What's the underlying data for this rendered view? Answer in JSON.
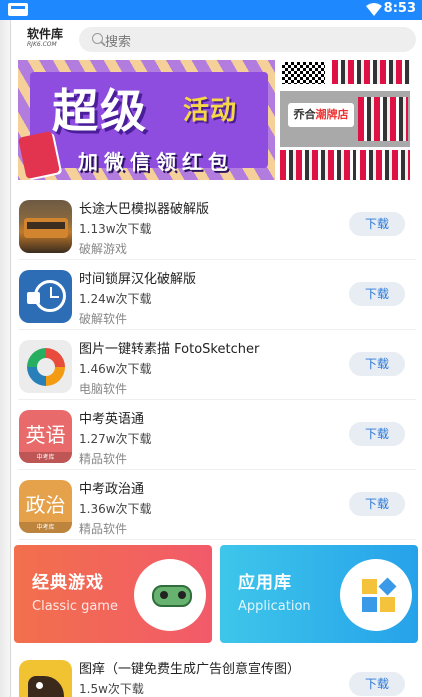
{
  "status_bar": {
    "time": "8:53"
  },
  "header": {
    "logo_main": "软件库",
    "logo_sub": "RJK6.COM",
    "search_placeholder": "搜索"
  },
  "banner": {
    "promo_title": "超级",
    "promo_title_2": "活动",
    "promo_subtitle": "加微信领红包",
    "shop_name_a": "乔合",
    "shop_name_b": "潮牌店"
  },
  "apps": [
    {
      "title": "长途大巴模拟器破解版",
      "count": "1.13w次下载",
      "category": "破解游戏",
      "button": "下载",
      "icon": "bus-icon"
    },
    {
      "title": "时间锁屏汉化破解版",
      "count": "1.24w次下载",
      "category": "破解软件",
      "button": "下载",
      "icon": "clock-lock-icon"
    },
    {
      "title": "图片一键转素描 FotoSketcher",
      "count": "1.46w次下载",
      "category": "电脑软件",
      "button": "下载",
      "icon": "photo-sketch-icon"
    },
    {
      "title": "中考英语通",
      "count": "1.27w次下载",
      "category": "精品软件",
      "button": "下载",
      "icon": "english-icon",
      "icon_text": "英语",
      "icon_sub": "中考库"
    },
    {
      "title": "中考政治通",
      "count": "1.36w次下载",
      "category": "精品软件",
      "button": "下载",
      "icon": "politics-icon",
      "icon_text": "政治",
      "icon_sub": "中考库"
    }
  ],
  "cards": {
    "games": {
      "title": "经典游戏",
      "subtitle": "Classic game"
    },
    "apps": {
      "title": "应用库",
      "subtitle": "Application"
    }
  },
  "apps_more": [
    {
      "title": "图痒（一键免费生成广告创意宣传图）",
      "count": "1.5w次下载",
      "button": "下载",
      "icon": "dog-icon"
    }
  ],
  "colors": {
    "status_bar": "#1e88ff",
    "download_text": "#2b78d8",
    "download_bg": "#e7edf3"
  }
}
